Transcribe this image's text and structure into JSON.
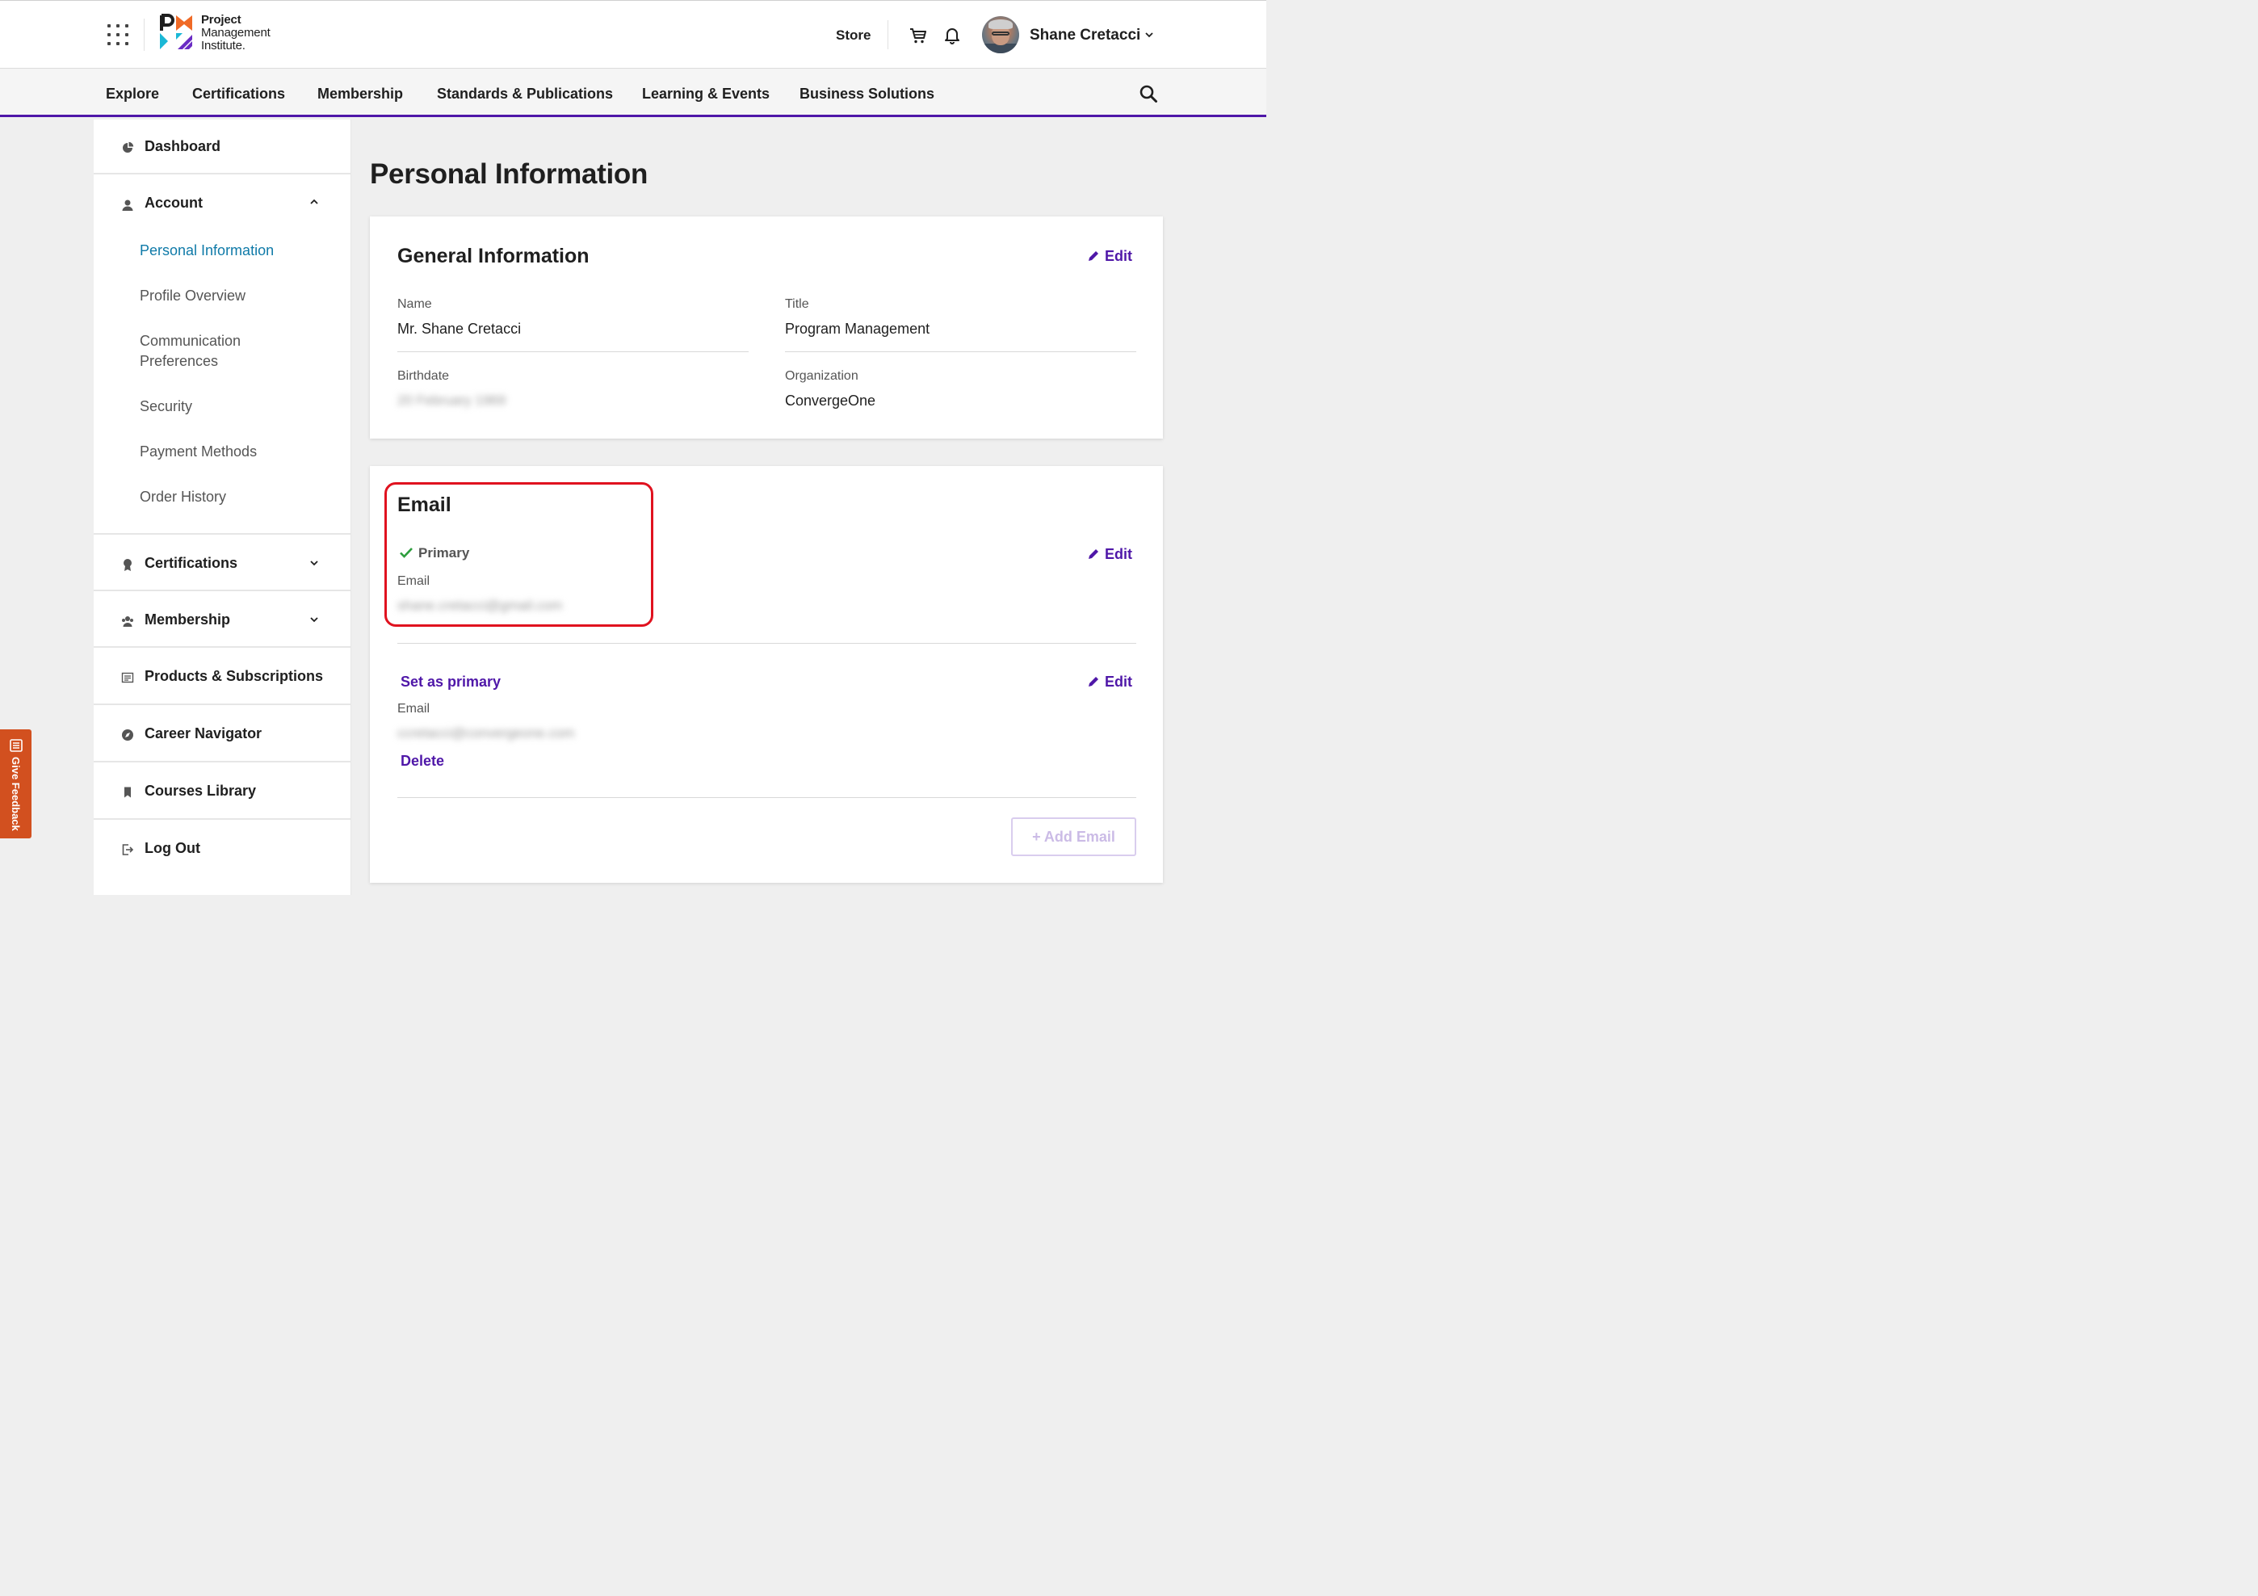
{
  "header": {
    "logo_line1": "Project",
    "logo_line2": "Management",
    "logo_line3": "Institute.",
    "store_label": "Store",
    "user_name": "Shane Cretacci"
  },
  "main_nav": {
    "items": [
      "Explore",
      "Certifications",
      "Membership",
      "Standards & Publications",
      "Learning & Events",
      "Business Solutions"
    ]
  },
  "sidebar": {
    "dashboard": "Dashboard",
    "account": "Account",
    "account_sub": [
      "Personal Information",
      "Profile Overview",
      "Communication Preferences",
      "Security",
      "Payment Methods",
      "Order History"
    ],
    "certifications": "Certifications",
    "membership": "Membership",
    "products": "Products & Subscriptions",
    "career": "Career Navigator",
    "courses": "Courses Library",
    "logout": "Log Out"
  },
  "page": {
    "title": "Personal Information"
  },
  "general": {
    "title": "General Information",
    "edit_label": "Edit",
    "name_label": "Name",
    "name_value": "Mr. Shane Cretacci",
    "title_label": "Title",
    "title_value": "Program Management",
    "birthdate_label": "Birthdate",
    "birthdate_value": "20 February 1969",
    "organization_label": "Organization",
    "organization_value": "ConvergeOne"
  },
  "email": {
    "title": "Email",
    "primary_label": "Primary",
    "edit_label": "Edit",
    "email_label": "Email",
    "primary_value": "shane.cretacci@gmail.com",
    "set_primary_label": "Set as primary",
    "secondary_edit_label": "Edit",
    "secondary_email_label": "Email",
    "secondary_value": "ccretacci@convergeone.com",
    "delete_label": "Delete",
    "add_email_label": "+ Add Email"
  },
  "feedback": {
    "label": "Give Feedback"
  },
  "colors": {
    "brand_purple": "#4f17a8",
    "active_link": "#0f7aa8",
    "highlight_red": "#e0121f",
    "feedback_orange": "#d2501f",
    "check_green": "#2e9e3e"
  }
}
